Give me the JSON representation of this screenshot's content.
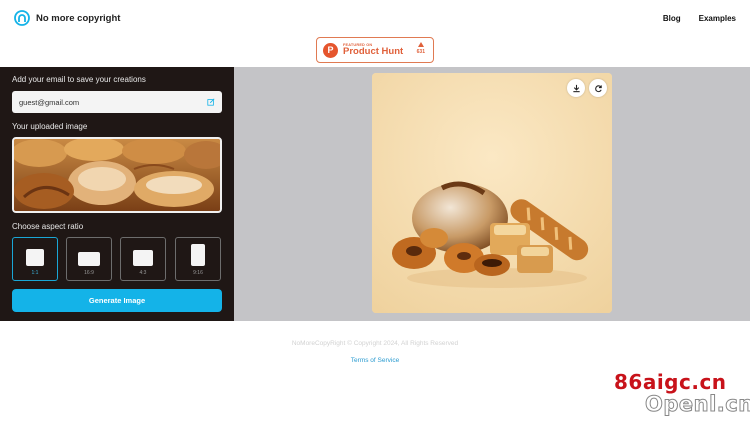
{
  "header": {
    "brand": "No more copyright",
    "nav": {
      "blog": "Blog",
      "examples": "Examples"
    }
  },
  "product_hunt": {
    "featured": "FEATURED ON",
    "name": "Product Hunt",
    "votes": "631",
    "logo_letter": "P"
  },
  "form": {
    "email_label": "Add your email to save your creations",
    "email_value": "guest@gmail.com",
    "upload_label": "Your uploaded image",
    "ratio_label": "Choose aspect ratio",
    "ratios": [
      {
        "label": "1:1",
        "selected": true
      },
      {
        "label": "16:9",
        "selected": false
      },
      {
        "label": "4:3",
        "selected": false
      },
      {
        "label": "9:16",
        "selected": false
      }
    ],
    "generate_label": "Generate Image"
  },
  "footer": {
    "copyright": "NoMoreCopyRight © Copyright 2024, All Rights Reserved",
    "terms": "Terms of Service"
  },
  "watermark": {
    "line1": "86aigc.cn",
    "line2": "Openl.cn"
  },
  "colors": {
    "accent": "#14b3e8",
    "panel": "#1f1715",
    "product_hunt": "#e0603a"
  }
}
